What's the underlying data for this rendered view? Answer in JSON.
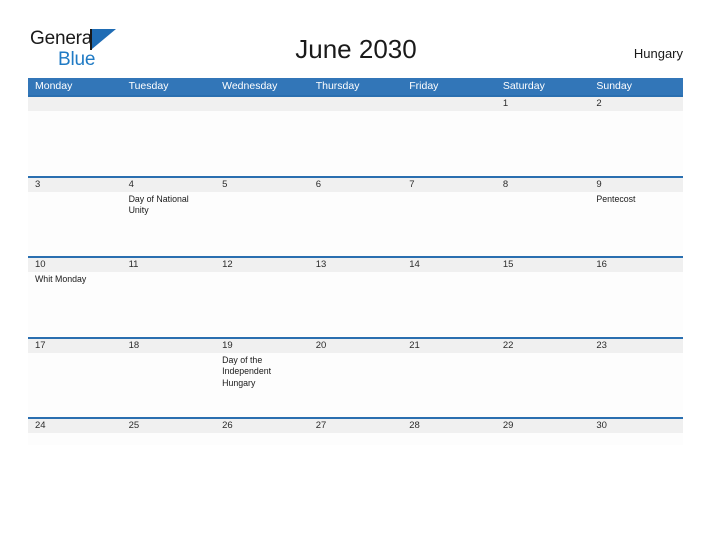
{
  "brand": {
    "name_part1": "General",
    "name_part2": "Blue",
    "flag_icon": "blue-triangle-flag-icon"
  },
  "header": {
    "title": "June 2030",
    "country": "Hungary"
  },
  "colors": {
    "header_blue": "#3276b8",
    "row_divider_blue": "#2a6fb0",
    "daynum_band": "#f0f0f0",
    "logo_blue": "#1f7ac4"
  },
  "calendar": {
    "weekdays": [
      "Monday",
      "Tuesday",
      "Wednesday",
      "Thursday",
      "Friday",
      "Saturday",
      "Sunday"
    ],
    "weeks": [
      {
        "days": [
          {
            "num": "",
            "event": ""
          },
          {
            "num": "",
            "event": ""
          },
          {
            "num": "",
            "event": ""
          },
          {
            "num": "",
            "event": ""
          },
          {
            "num": "",
            "event": ""
          },
          {
            "num": "1",
            "event": ""
          },
          {
            "num": "2",
            "event": ""
          }
        ]
      },
      {
        "days": [
          {
            "num": "3",
            "event": ""
          },
          {
            "num": "4",
            "event": "Day of National Unity"
          },
          {
            "num": "5",
            "event": ""
          },
          {
            "num": "6",
            "event": ""
          },
          {
            "num": "7",
            "event": ""
          },
          {
            "num": "8",
            "event": ""
          },
          {
            "num": "9",
            "event": "Pentecost"
          }
        ]
      },
      {
        "days": [
          {
            "num": "10",
            "event": "Whit Monday"
          },
          {
            "num": "11",
            "event": ""
          },
          {
            "num": "12",
            "event": ""
          },
          {
            "num": "13",
            "event": ""
          },
          {
            "num": "14",
            "event": ""
          },
          {
            "num": "15",
            "event": ""
          },
          {
            "num": "16",
            "event": ""
          }
        ]
      },
      {
        "days": [
          {
            "num": "17",
            "event": ""
          },
          {
            "num": "18",
            "event": ""
          },
          {
            "num": "19",
            "event": "Day of the Independent Hungary"
          },
          {
            "num": "20",
            "event": ""
          },
          {
            "num": "21",
            "event": ""
          },
          {
            "num": "22",
            "event": ""
          },
          {
            "num": "23",
            "event": ""
          }
        ]
      },
      {
        "days": [
          {
            "num": "24",
            "event": ""
          },
          {
            "num": "25",
            "event": ""
          },
          {
            "num": "26",
            "event": ""
          },
          {
            "num": "27",
            "event": ""
          },
          {
            "num": "28",
            "event": ""
          },
          {
            "num": "29",
            "event": ""
          },
          {
            "num": "30",
            "event": ""
          }
        ]
      }
    ]
  }
}
